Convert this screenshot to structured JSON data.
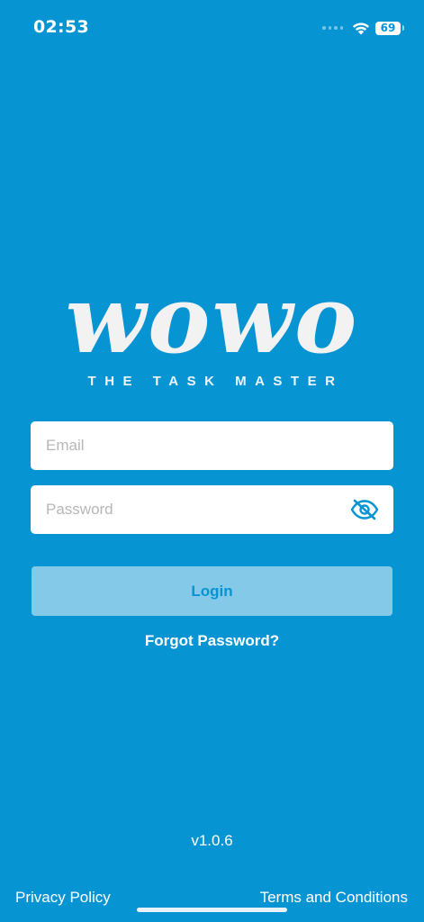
{
  "status_bar": {
    "time": "02:53",
    "battery_level": "69",
    "wifi_icon": "wifi-icon",
    "signal_icon": "cellular-signal-icon"
  },
  "logo": {
    "wordmark": "wowo",
    "tagline": "THE TASK MASTER"
  },
  "form": {
    "email": {
      "placeholder": "Email",
      "value": ""
    },
    "password": {
      "placeholder": "Password",
      "value": "",
      "toggle_icon": "eye-slash-icon"
    },
    "login_label": "Login",
    "forgot_password_label": "Forgot Password?"
  },
  "footer": {
    "version": "v1.0.6",
    "privacy_label": "Privacy Policy",
    "terms_label": "Terms and Conditions"
  },
  "colors": {
    "background": "#0794d3",
    "button_disabled": "#84c9e8",
    "text": "#ffffff"
  }
}
